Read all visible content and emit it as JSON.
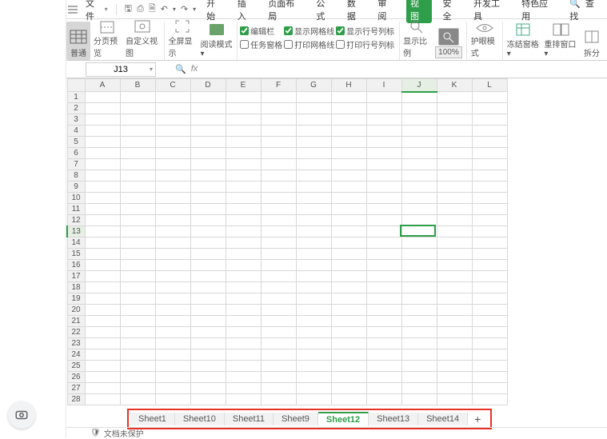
{
  "menu": {
    "file": "文件",
    "tabs": {
      "start": "开始",
      "insert": "插入",
      "page": "页面布局",
      "formula": "公式",
      "data": "数据",
      "review": "审阅",
      "view": "视图",
      "security": "安全",
      "dev": "开发工具",
      "special": "特色应用",
      "find": "查找"
    }
  },
  "ribbon": {
    "normal": "普通",
    "page_preview": "分页预览",
    "custom_view": "自定义视图",
    "full_screen": "全屏显示",
    "read_mode": "阅读模式",
    "chk": {
      "formula_bar": "编辑栏",
      "gridlines": "显示网格线",
      "headings": "显示行号列标",
      "task_pane": "任务窗格",
      "print_grid": "打印网格线",
      "print_headings": "打印行号列标"
    },
    "zoom_ratio": "显示比例",
    "zoom_value": "100%",
    "eye_mode": "护眼模式",
    "freeze": "冻结窗格",
    "arrange": "重排窗口",
    "split": "拆分"
  },
  "formula_bar": {
    "cell_ref": "J13",
    "fx": "fx"
  },
  "columns": [
    "A",
    "B",
    "C",
    "D",
    "E",
    "F",
    "G",
    "H",
    "I",
    "J",
    "K",
    "L"
  ],
  "rows": [
    1,
    2,
    3,
    4,
    5,
    6,
    7,
    8,
    9,
    10,
    11,
    12,
    13,
    14,
    15,
    16,
    17,
    18,
    19,
    20,
    21,
    22,
    23,
    24,
    25,
    26,
    27,
    28
  ],
  "active_cell": {
    "row": 13,
    "col": "J"
  },
  "sheet_tabs": {
    "items": [
      "Sheet1",
      "Sheet10",
      "Sheet11",
      "Sheet9",
      "Sheet12",
      "Sheet13",
      "Sheet14"
    ],
    "active_index": 4
  },
  "status": {
    "protect": "文档未保护"
  }
}
